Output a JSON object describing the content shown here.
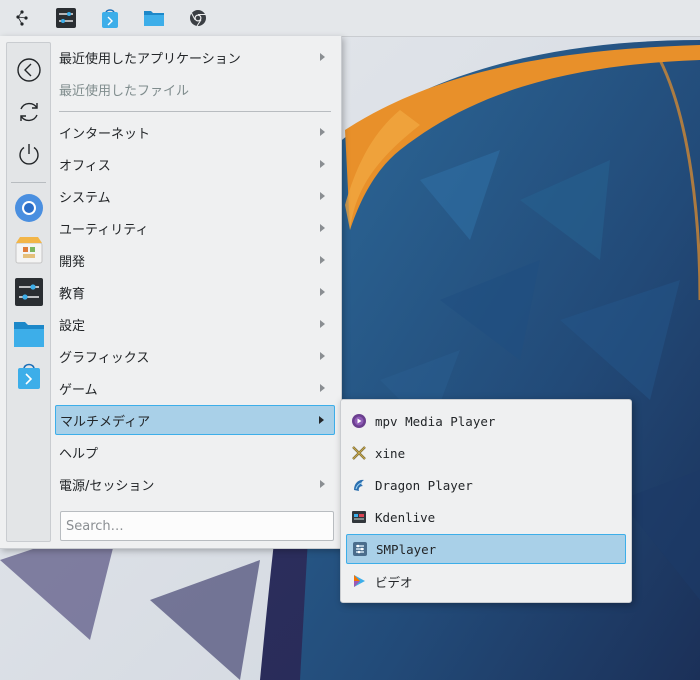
{
  "menu": {
    "items": [
      {
        "label": "最近使用したアプリケーション",
        "submenu": true
      },
      {
        "label": "最近使用したファイル",
        "submenu": false,
        "disabled": true
      },
      {
        "label": "インターネット",
        "submenu": true
      },
      {
        "label": "オフィス",
        "submenu": true
      },
      {
        "label": "システム",
        "submenu": true
      },
      {
        "label": "ユーティリティ",
        "submenu": true
      },
      {
        "label": "開発",
        "submenu": true
      },
      {
        "label": "教育",
        "submenu": true
      },
      {
        "label": "設定",
        "submenu": true
      },
      {
        "label": "グラフィックス",
        "submenu": true
      },
      {
        "label": "ゲーム",
        "submenu": true
      },
      {
        "label": "マルチメディア",
        "submenu": true,
        "selected": true
      },
      {
        "label": "ヘルプ",
        "submenu": false
      },
      {
        "label": "電源/セッション",
        "submenu": true
      }
    ],
    "search": {
      "placeholder": "Search…",
      "value": ""
    }
  },
  "submenu": {
    "items": [
      {
        "label": "mpv Media Player",
        "icon": "mpv-icon"
      },
      {
        "label": "xine",
        "icon": "xine-icon"
      },
      {
        "label": "Dragon Player",
        "icon": "dragon-player-icon"
      },
      {
        "label": "Kdenlive",
        "icon": "kdenlive-icon"
      },
      {
        "label": "SMPlayer",
        "icon": "smplayer-icon",
        "selected": true
      },
      {
        "label": "ビデオ",
        "icon": "video-icon"
      }
    ]
  },
  "colors": {
    "accent": "#3daee9",
    "selection": "#a9d0e8",
    "menu_bg": "#eff0f1",
    "panel_bg": "#e4e7ea"
  }
}
